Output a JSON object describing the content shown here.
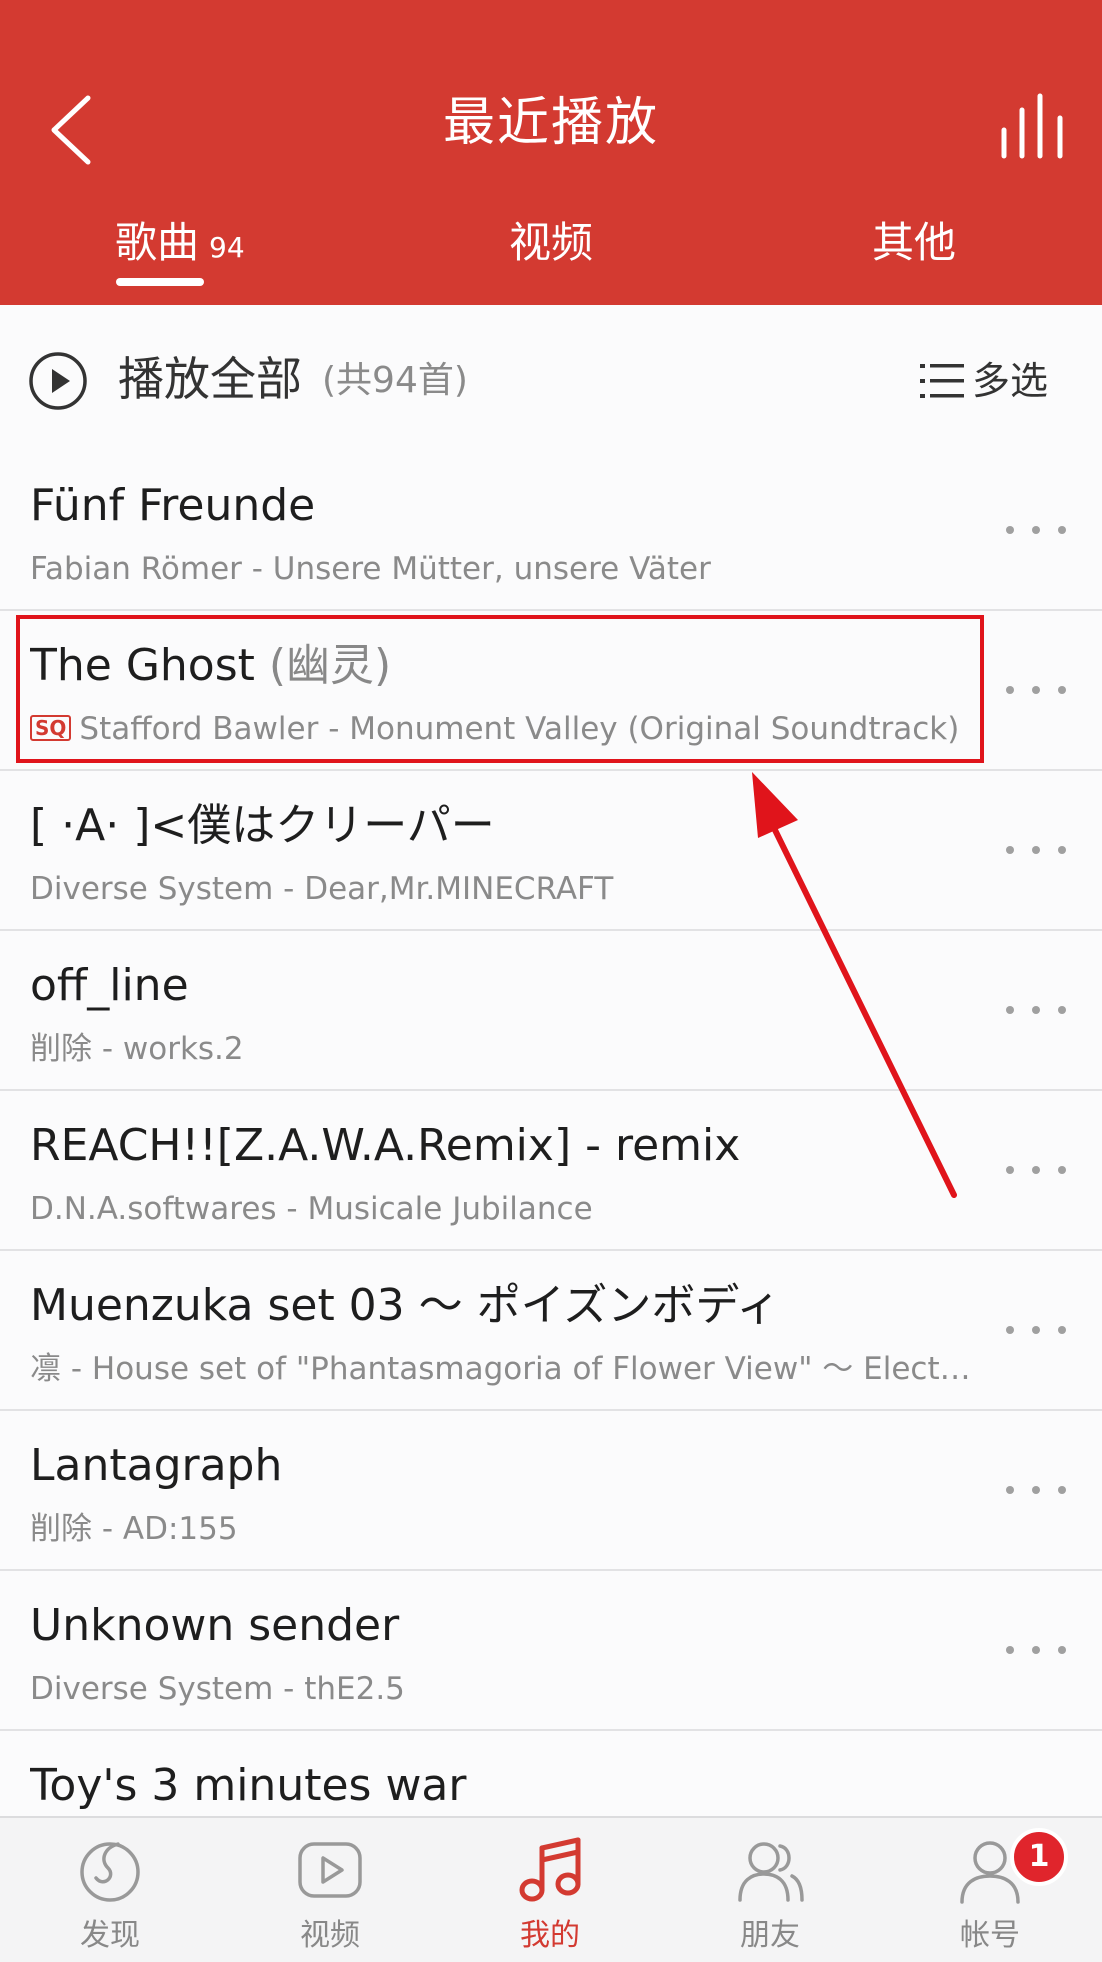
{
  "header": {
    "title": "最近播放",
    "tabs": [
      {
        "label": "歌曲",
        "count": "94"
      },
      {
        "label": "视频"
      },
      {
        "label": "其他"
      }
    ]
  },
  "play_all": {
    "label": "播放全部",
    "count": "(共94首)",
    "multi_select": "多选"
  },
  "songs": [
    {
      "title": "Fünf Freunde",
      "alias": "",
      "subtitle": "Fabian Römer - Unsere Mütter, unsere Väter",
      "badge": ""
    },
    {
      "title": "The Ghost",
      "alias": " (幽灵)",
      "subtitle": "Stafford Bawler - Monument Valley (Original Soundtrack)",
      "badge": "SQ"
    },
    {
      "title": "[ ·A· ]<僕はクリーパー",
      "alias": "",
      "subtitle": "Diverse System - Dear,Mr.MINECRAFT",
      "badge": ""
    },
    {
      "title": "off_line",
      "alias": "",
      "subtitle": "削除 - works.2",
      "badge": ""
    },
    {
      "title": "REACH!![Z.A.W.A.Remix] - remix",
      "alias": "",
      "subtitle": "D.N.A.softwares - Musicale Jubilance",
      "badge": ""
    },
    {
      "title": "Muenzuka set 03 ～ ポイズンボディ",
      "alias": "",
      "subtitle": "凛 - House set of \"Phantasmagoria of Flower View\" ～ Electro Remix",
      "badge": ""
    },
    {
      "title": "Lantagraph",
      "alias": "",
      "subtitle": "削除 - AD:155",
      "badge": ""
    },
    {
      "title": "Unknown sender",
      "alias": "",
      "subtitle": "Diverse System - thE2.5",
      "badge": ""
    },
    {
      "title": "Toy's 3 minutes war",
      "alias": "",
      "subtitle": "",
      "badge": ""
    }
  ],
  "bottom_nav": [
    {
      "label": "发现",
      "icon": "discover-icon"
    },
    {
      "label": "视频",
      "icon": "video-icon"
    },
    {
      "label": "我的",
      "icon": "music-note-icon",
      "active": true
    },
    {
      "label": "朋友",
      "icon": "friends-icon"
    },
    {
      "label": "帐号",
      "icon": "account-icon",
      "badge": "1"
    }
  ],
  "colors": {
    "accent": "#d33a31",
    "annotation": "#e0141b"
  }
}
